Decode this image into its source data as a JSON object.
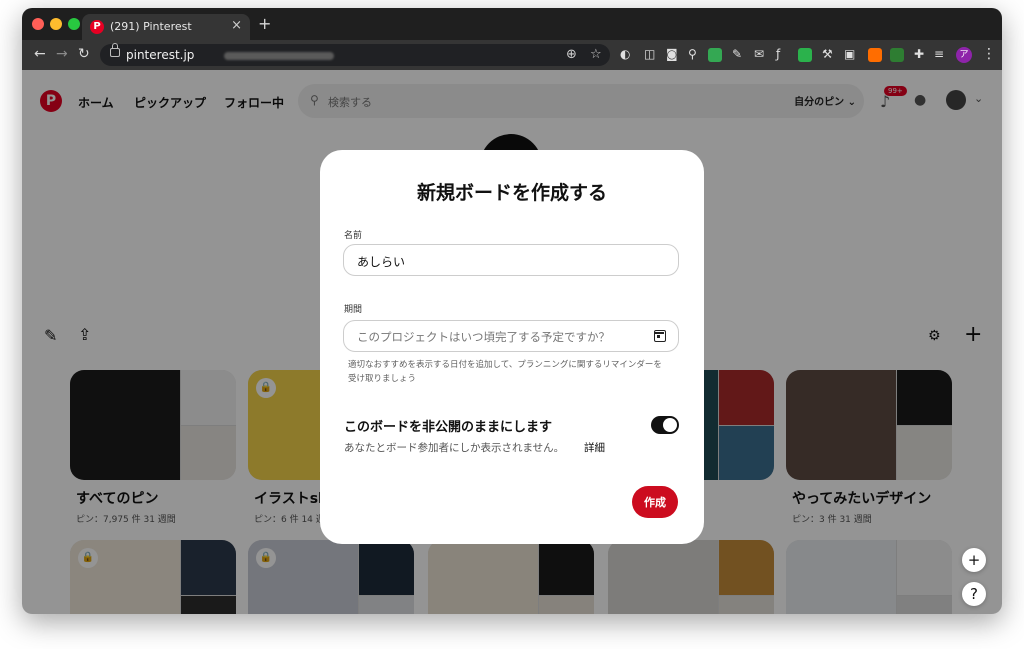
{
  "browser": {
    "tab_title": "(291) Pinterest",
    "tab_favicon": "P",
    "url": "pinterest.jp",
    "new_tab": "+",
    "tab_close": "×",
    "profile_initial": "ア"
  },
  "site_header": {
    "logo": "P",
    "nav": [
      "ホーム",
      "ピックアップ",
      "フォロー中"
    ],
    "search_placeholder": "検索する",
    "scope_label": "自分のピン ⌄",
    "notification_badge": "99+"
  },
  "boards": [
    {
      "title": "すべてのピン",
      "meta": "ピン：7,975 件  31 週間",
      "locked": false,
      "colors": [
        "#1d1d1d",
        "#f2f2f2",
        "#e9e6e1"
      ]
    },
    {
      "title": "イラストsl",
      "meta": "ピン：6 件  14 週",
      "locked": true,
      "colors": [
        "#f3d34a",
        "#1d3a66",
        "#e8e5da"
      ]
    },
    {
      "title": "",
      "meta": "",
      "locked": false,
      "colors": [
        "#204b55",
        "#a92a2a",
        "#3c6e8f"
      ]
    },
    {
      "title": "やってみたいデザイン",
      "meta": "ピン：3 件  31 週間",
      "locked": false,
      "colors": [
        "#5d4a42",
        "#1b1b1b",
        "#e7e5e0"
      ]
    }
  ],
  "boards_row2_colors": [
    [
      "#efe7da",
      "#2b3a4c",
      "#2d2d2d"
    ],
    [
      "#c9ccd6",
      "#1e2b3b",
      "#dfe0e4"
    ],
    [
      "#ece3d4",
      "#1a1a1a",
      "#e7e1d6"
    ],
    [
      "#d8d6d2",
      "#c48c3a",
      "#e3e0da"
    ],
    [
      "#e9edf0",
      "#f2f2f2",
      "#dcdcdc"
    ]
  ],
  "modal": {
    "title": "新規ボードを作成する",
    "name_label": "名前",
    "name_value": "あしらい",
    "period_label": "期間",
    "period_placeholder": "このプロジェクトはいつ頃完了する予定ですか？",
    "period_help": "適切なおすすめを表示する日付を追加して、プランニングに関するリマインダーを受け取りましょう",
    "private_title": "このボードを非公開のままにします",
    "private_desc": "あなたとボード参加者にしか表示されません。",
    "private_more": "詳細",
    "private_enabled": true,
    "create_label": "作成"
  },
  "floating": {
    "plus": "+",
    "help": "?"
  }
}
